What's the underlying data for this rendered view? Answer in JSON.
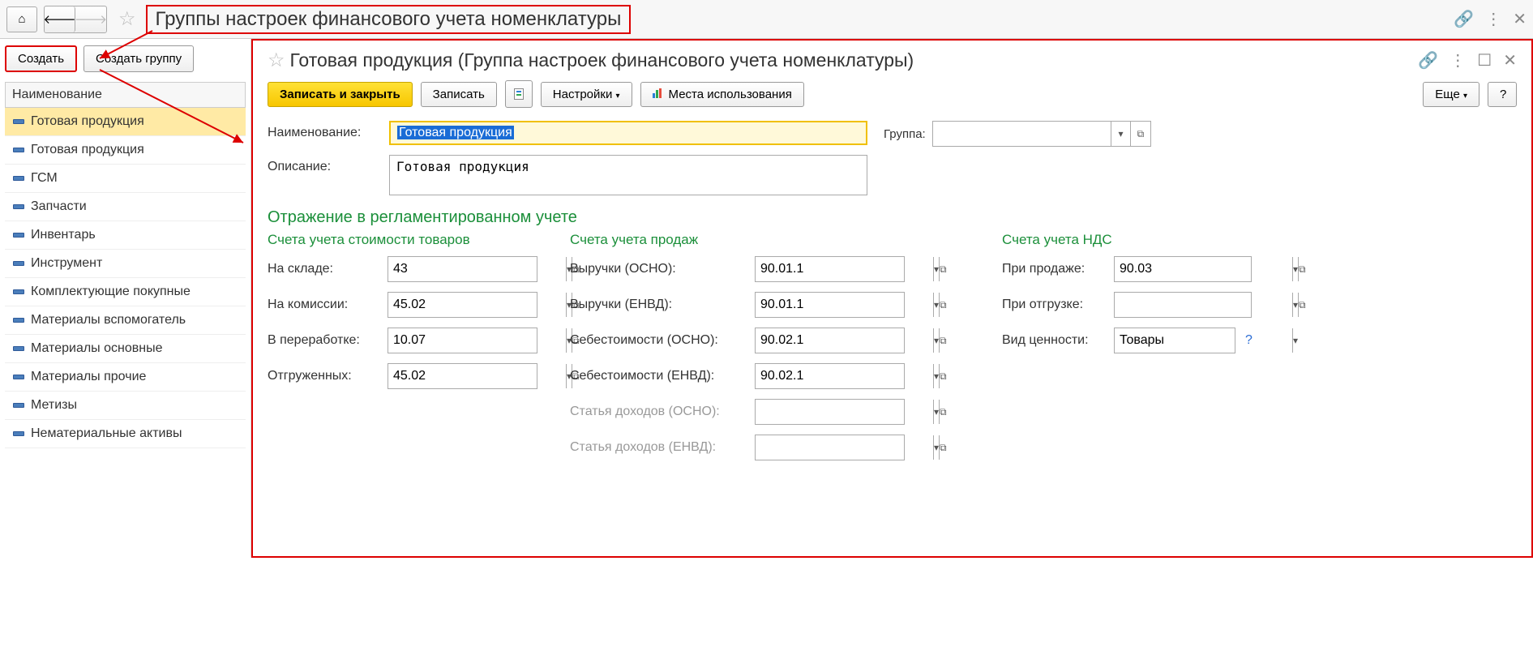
{
  "header": {
    "title": "Группы настроек финансового учета номенклатуры"
  },
  "sidebar": {
    "create_btn": "Создать",
    "create_group_btn": "Создать группу",
    "column_header": "Наименование",
    "items": [
      {
        "label": "Готовая продукция"
      },
      {
        "label": "Готовая продукция"
      },
      {
        "label": "ГСМ"
      },
      {
        "label": "Запчасти"
      },
      {
        "label": "Инвентарь"
      },
      {
        "label": "Инструмент"
      },
      {
        "label": "Комплектующие покупные"
      },
      {
        "label": "Материалы вспомогатель"
      },
      {
        "label": "Материалы основные"
      },
      {
        "label": "Материалы прочие"
      },
      {
        "label": "Метизы"
      },
      {
        "label": "Нематериальные активы"
      }
    ]
  },
  "form": {
    "title": "Готовая продукция (Группа настроек финансового учета номенклатуры)",
    "toolbar": {
      "save_close": "Записать и закрыть",
      "save": "Записать",
      "settings": "Настройки",
      "usage": "Места использования",
      "more": "Еще",
      "help": "?"
    },
    "fields": {
      "name_label": "Наименование:",
      "name_value": "Готовая продукция",
      "group_label": "Группа:",
      "group_value": "",
      "description_label": "Описание:",
      "description_value": "Готовая продукция"
    },
    "section": "Отражение в регламентированном учете",
    "cost": {
      "title": "Счета учета стоимости товаров",
      "warehouse_label": "На складе:",
      "warehouse_value": "43",
      "commission_label": "На комиссии:",
      "commission_value": "45.02",
      "processing_label": "В переработке:",
      "processing_value": "10.07",
      "shipped_label": "Отгруженных:",
      "shipped_value": "45.02"
    },
    "sales": {
      "title": "Счета учета продаж",
      "rev_osno_label": "Выручки (ОСНО):",
      "rev_osno_value": "90.01.1",
      "rev_envd_label": "Выручки (ЕНВД):",
      "rev_envd_value": "90.01.1",
      "cost_osno_label": "Себестоимости (ОСНО):",
      "cost_osno_value": "90.02.1",
      "cost_envd_label": "Себестоимости (ЕНВД):",
      "cost_envd_value": "90.02.1",
      "income_osno_label": "Статья доходов (ОСНО):",
      "income_osno_value": "",
      "income_envd_label": "Статья доходов (ЕНВД):",
      "income_envd_value": ""
    },
    "vat": {
      "title": "Счета учета НДС",
      "on_sale_label": "При продаже:",
      "on_sale_value": "90.03",
      "on_ship_label": "При отгрузке:",
      "on_ship_value": "",
      "value_type_label": "Вид ценности:",
      "value_type_value": "Товары"
    }
  }
}
